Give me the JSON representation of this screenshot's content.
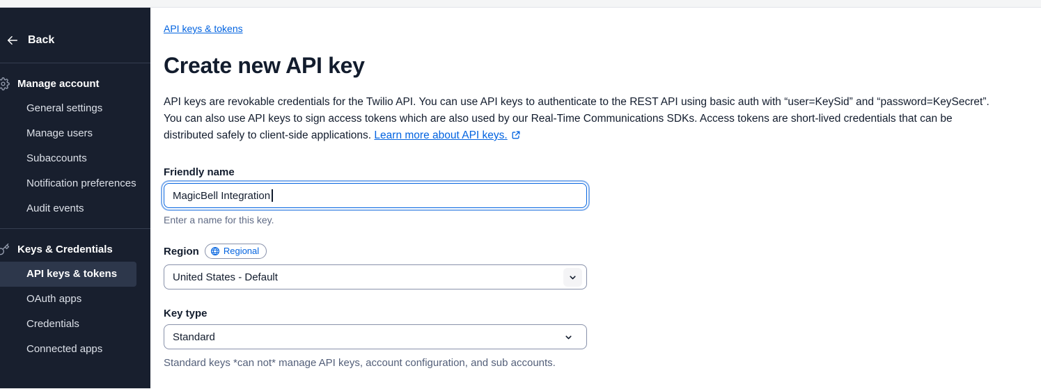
{
  "sidebar": {
    "back_label": "Back",
    "sections": [
      {
        "label": "Manage account",
        "icon": "gear-icon",
        "items": [
          "General settings",
          "Manage users",
          "Subaccounts",
          "Notification preferences",
          "Audit events"
        ]
      },
      {
        "label": "Keys & Credentials",
        "icon": "key-icon",
        "items": [
          "API keys & tokens",
          "OAuth apps",
          "Credentials",
          "Connected apps"
        ],
        "active_item": "API keys & tokens"
      }
    ]
  },
  "main": {
    "breadcrumb": "API keys & tokens",
    "title": "Create new API key",
    "description": "API keys are revokable credentials for the Twilio API. You can use API keys to authenticate to the REST API using basic auth with “user=KeySid” and “password=KeySecret”. You can also use API keys to sign access tokens which are also used by our Real-Time Communications SDKs. Access tokens are short-lived credentials that can be distributed safely to client-side applications.",
    "learn_more": "Learn more about API keys.",
    "form": {
      "friendly_name": {
        "label": "Friendly name",
        "value": "MagicBell Integration",
        "help": "Enter a name for this key."
      },
      "region": {
        "label": "Region",
        "badge": "Regional",
        "value": "United States - Default"
      },
      "key_type": {
        "label": "Key type",
        "value": "Standard",
        "help": "Standard keys *can not* manage API keys, account configuration, and sub accounts."
      }
    }
  },
  "colors": {
    "accent_blue": "#0263E0",
    "sidebar_bg": "#181F2E",
    "sidebar_active_bg": "#2D374B",
    "text_primary": "#121C2D",
    "text_weak": "#606B85",
    "border": "#8891AA",
    "topbar_bg": "#F4F5F6"
  }
}
